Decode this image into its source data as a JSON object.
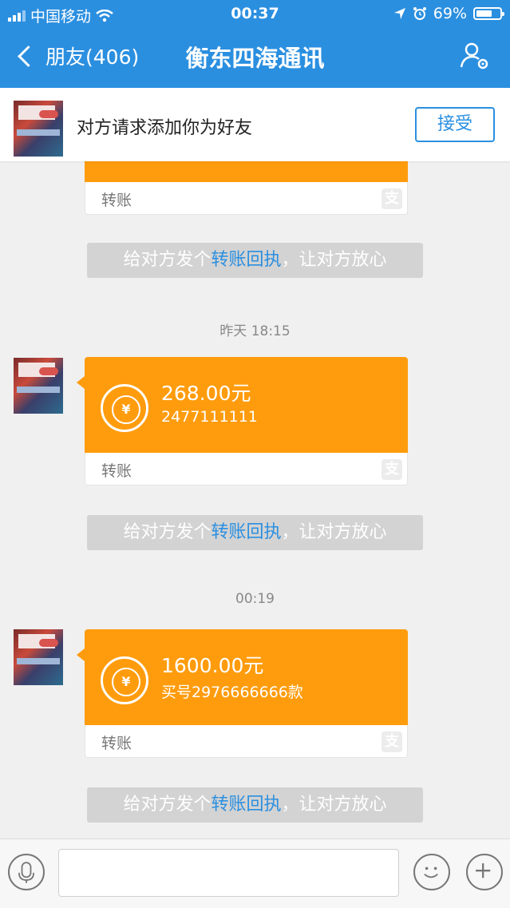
{
  "status_bar": {
    "carrier": "中国移动",
    "time": "00:37",
    "battery": "69%",
    "battery_level": 0.69
  },
  "nav": {
    "back_label": "朋友(406)",
    "title": "衡东四海通讯"
  },
  "friend_request": {
    "text": "对方请求添加你为好友",
    "accept_label": "接受"
  },
  "messages": [
    {
      "type": "transfer_partial",
      "footer_label": "转账"
    },
    {
      "type": "system",
      "prefix": "给对方发个",
      "link": "转账回执",
      "suffix": "，让对方放心"
    },
    {
      "type": "timestamp",
      "text": "昨天 18:15"
    },
    {
      "type": "transfer",
      "amount": "268.00元",
      "note": "2477111111",
      "footer_label": "转账"
    },
    {
      "type": "system",
      "prefix": "给对方发个",
      "link": "转账回执",
      "suffix": "，让对方放心"
    },
    {
      "type": "timestamp",
      "text": "00:19"
    },
    {
      "type": "transfer",
      "amount": "1600.00元",
      "note": "买号2976666666款",
      "footer_label": "转账"
    },
    {
      "type": "system",
      "prefix": "给对方发个",
      "link": "转账回执",
      "suffix": "，让对方放心"
    }
  ],
  "icons": {
    "currency_symbol": "¥",
    "alipay_symbol": "支"
  },
  "colors": {
    "brand_blue": "#2b8fe0",
    "transfer_orange": "#ff9c0d"
  }
}
